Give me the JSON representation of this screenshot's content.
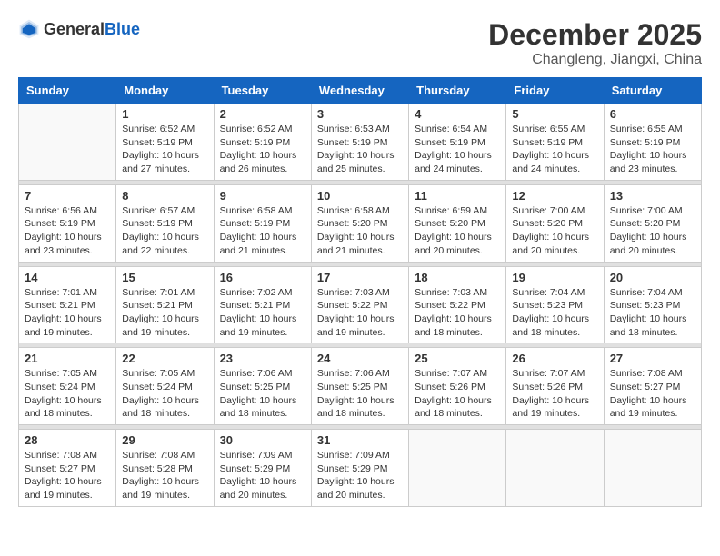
{
  "header": {
    "logo_general": "General",
    "logo_blue": "Blue",
    "month": "December 2025",
    "location": "Changleng, Jiangxi, China"
  },
  "weekdays": [
    "Sunday",
    "Monday",
    "Tuesday",
    "Wednesday",
    "Thursday",
    "Friday",
    "Saturday"
  ],
  "weeks": [
    [
      {
        "day": "",
        "info": ""
      },
      {
        "day": "1",
        "info": "Sunrise: 6:52 AM\nSunset: 5:19 PM\nDaylight: 10 hours\nand 27 minutes."
      },
      {
        "day": "2",
        "info": "Sunrise: 6:52 AM\nSunset: 5:19 PM\nDaylight: 10 hours\nand 26 minutes."
      },
      {
        "day": "3",
        "info": "Sunrise: 6:53 AM\nSunset: 5:19 PM\nDaylight: 10 hours\nand 25 minutes."
      },
      {
        "day": "4",
        "info": "Sunrise: 6:54 AM\nSunset: 5:19 PM\nDaylight: 10 hours\nand 24 minutes."
      },
      {
        "day": "5",
        "info": "Sunrise: 6:55 AM\nSunset: 5:19 PM\nDaylight: 10 hours\nand 24 minutes."
      },
      {
        "day": "6",
        "info": "Sunrise: 6:55 AM\nSunset: 5:19 PM\nDaylight: 10 hours\nand 23 minutes."
      }
    ],
    [
      {
        "day": "7",
        "info": "Sunrise: 6:56 AM\nSunset: 5:19 PM\nDaylight: 10 hours\nand 23 minutes."
      },
      {
        "day": "8",
        "info": "Sunrise: 6:57 AM\nSunset: 5:19 PM\nDaylight: 10 hours\nand 22 minutes."
      },
      {
        "day": "9",
        "info": "Sunrise: 6:58 AM\nSunset: 5:19 PM\nDaylight: 10 hours\nand 21 minutes."
      },
      {
        "day": "10",
        "info": "Sunrise: 6:58 AM\nSunset: 5:20 PM\nDaylight: 10 hours\nand 21 minutes."
      },
      {
        "day": "11",
        "info": "Sunrise: 6:59 AM\nSunset: 5:20 PM\nDaylight: 10 hours\nand 20 minutes."
      },
      {
        "day": "12",
        "info": "Sunrise: 7:00 AM\nSunset: 5:20 PM\nDaylight: 10 hours\nand 20 minutes."
      },
      {
        "day": "13",
        "info": "Sunrise: 7:00 AM\nSunset: 5:20 PM\nDaylight: 10 hours\nand 20 minutes."
      }
    ],
    [
      {
        "day": "14",
        "info": "Sunrise: 7:01 AM\nSunset: 5:21 PM\nDaylight: 10 hours\nand 19 minutes."
      },
      {
        "day": "15",
        "info": "Sunrise: 7:01 AM\nSunset: 5:21 PM\nDaylight: 10 hours\nand 19 minutes."
      },
      {
        "day": "16",
        "info": "Sunrise: 7:02 AM\nSunset: 5:21 PM\nDaylight: 10 hours\nand 19 minutes."
      },
      {
        "day": "17",
        "info": "Sunrise: 7:03 AM\nSunset: 5:22 PM\nDaylight: 10 hours\nand 19 minutes."
      },
      {
        "day": "18",
        "info": "Sunrise: 7:03 AM\nSunset: 5:22 PM\nDaylight: 10 hours\nand 18 minutes."
      },
      {
        "day": "19",
        "info": "Sunrise: 7:04 AM\nSunset: 5:23 PM\nDaylight: 10 hours\nand 18 minutes."
      },
      {
        "day": "20",
        "info": "Sunrise: 7:04 AM\nSunset: 5:23 PM\nDaylight: 10 hours\nand 18 minutes."
      }
    ],
    [
      {
        "day": "21",
        "info": "Sunrise: 7:05 AM\nSunset: 5:24 PM\nDaylight: 10 hours\nand 18 minutes."
      },
      {
        "day": "22",
        "info": "Sunrise: 7:05 AM\nSunset: 5:24 PM\nDaylight: 10 hours\nand 18 minutes."
      },
      {
        "day": "23",
        "info": "Sunrise: 7:06 AM\nSunset: 5:25 PM\nDaylight: 10 hours\nand 18 minutes."
      },
      {
        "day": "24",
        "info": "Sunrise: 7:06 AM\nSunset: 5:25 PM\nDaylight: 10 hours\nand 18 minutes."
      },
      {
        "day": "25",
        "info": "Sunrise: 7:07 AM\nSunset: 5:26 PM\nDaylight: 10 hours\nand 18 minutes."
      },
      {
        "day": "26",
        "info": "Sunrise: 7:07 AM\nSunset: 5:26 PM\nDaylight: 10 hours\nand 19 minutes."
      },
      {
        "day": "27",
        "info": "Sunrise: 7:08 AM\nSunset: 5:27 PM\nDaylight: 10 hours\nand 19 minutes."
      }
    ],
    [
      {
        "day": "28",
        "info": "Sunrise: 7:08 AM\nSunset: 5:27 PM\nDaylight: 10 hours\nand 19 minutes."
      },
      {
        "day": "29",
        "info": "Sunrise: 7:08 AM\nSunset: 5:28 PM\nDaylight: 10 hours\nand 19 minutes."
      },
      {
        "day": "30",
        "info": "Sunrise: 7:09 AM\nSunset: 5:29 PM\nDaylight: 10 hours\nand 20 minutes."
      },
      {
        "day": "31",
        "info": "Sunrise: 7:09 AM\nSunset: 5:29 PM\nDaylight: 10 hours\nand 20 minutes."
      },
      {
        "day": "",
        "info": ""
      },
      {
        "day": "",
        "info": ""
      },
      {
        "day": "",
        "info": ""
      }
    ]
  ]
}
